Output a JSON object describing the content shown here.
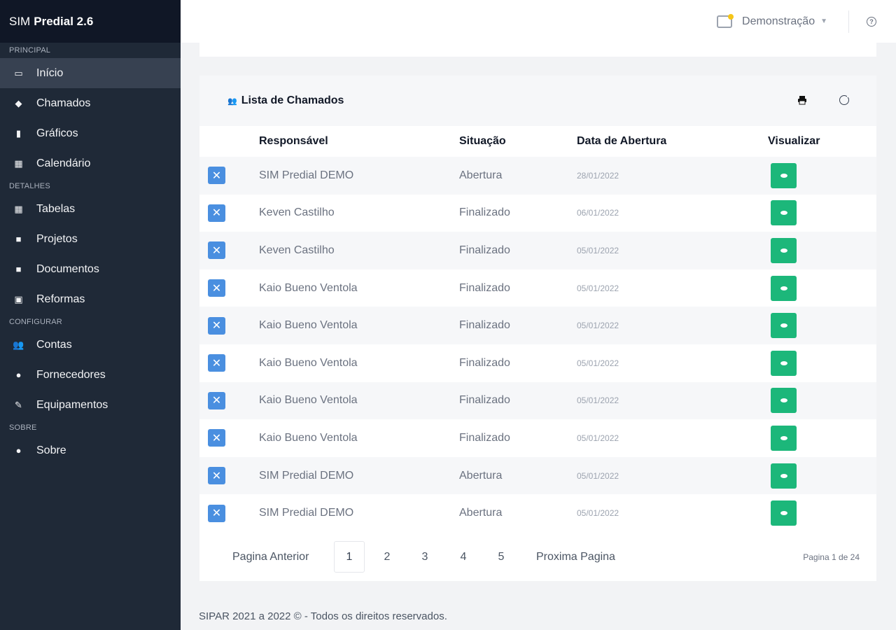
{
  "brand": {
    "prefix": "SIM",
    "name": "Predial 2.6"
  },
  "sidebar": {
    "sections": [
      {
        "label": "PRINCIPAL",
        "items": [
          {
            "label": "Início",
            "icon": "monitor-icon",
            "glyph": "▭",
            "active": true
          },
          {
            "label": "Chamados",
            "icon": "bullhorn-icon",
            "glyph": "◆"
          },
          {
            "label": "Gráficos",
            "icon": "chart-bar-icon",
            "glyph": "▮"
          },
          {
            "label": "Calendário",
            "icon": "calendar-icon",
            "glyph": "▦"
          }
        ]
      },
      {
        "label": "DETALHES",
        "items": [
          {
            "label": "Tabelas",
            "icon": "table-icon",
            "glyph": "▦"
          },
          {
            "label": "Projetos",
            "icon": "book-icon",
            "glyph": "■"
          },
          {
            "label": "Documentos",
            "icon": "document-icon",
            "glyph": "■"
          },
          {
            "label": "Reformas",
            "icon": "clipboard-icon",
            "glyph": "▣"
          }
        ]
      },
      {
        "label": "CONFIGURAR",
        "items": [
          {
            "label": "Contas",
            "icon": "users-icon",
            "glyph": "👥"
          },
          {
            "label": "Fornecedores",
            "icon": "user-icon",
            "glyph": "●"
          },
          {
            "label": "Equipamentos",
            "icon": "wrench-icon",
            "glyph": "✎"
          }
        ]
      },
      {
        "label": "SOBRE",
        "items": [
          {
            "label": "Sobre",
            "icon": "info-circle-icon",
            "glyph": "●"
          }
        ]
      }
    ]
  },
  "topbar": {
    "org_name": "Demonstração",
    "help_glyph": "?"
  },
  "card": {
    "title": "Lista de Chamados",
    "columns": {
      "responsavel": "Responsável",
      "situacao": "Situação",
      "data": "Data de Abertura",
      "visualizar": "Visualizar"
    },
    "rows": [
      {
        "responsavel": "SIM Predial DEMO",
        "situacao": "Abertura",
        "data": "28/01/2022"
      },
      {
        "responsavel": "Keven Castilho",
        "situacao": "Finalizado",
        "data": "06/01/2022"
      },
      {
        "responsavel": "Keven Castilho",
        "situacao": "Finalizado",
        "data": "05/01/2022"
      },
      {
        "responsavel": "Kaio Bueno Ventola",
        "situacao": "Finalizado",
        "data": "05/01/2022"
      },
      {
        "responsavel": "Kaio Bueno Ventola",
        "situacao": "Finalizado",
        "data": "05/01/2022"
      },
      {
        "responsavel": "Kaio Bueno Ventola",
        "situacao": "Finalizado",
        "data": "05/01/2022"
      },
      {
        "responsavel": "Kaio Bueno Ventola",
        "situacao": "Finalizado",
        "data": "05/01/2022"
      },
      {
        "responsavel": "Kaio Bueno Ventola",
        "situacao": "Finalizado",
        "data": "05/01/2022"
      },
      {
        "responsavel": "SIM Predial DEMO",
        "situacao": "Abertura",
        "data": "05/01/2022"
      },
      {
        "responsavel": "SIM Predial DEMO",
        "situacao": "Abertura",
        "data": "05/01/2022"
      }
    ]
  },
  "pagination": {
    "prev_label": "Pagina Anterior",
    "pages": [
      "1",
      "2",
      "3",
      "4",
      "5"
    ],
    "current": "1",
    "next_label": "Proxima Pagina",
    "info": "Pagina 1 de 24"
  },
  "footer": {
    "text": "SIPAR 2021 a 2022 © - Todos os direitos reservados."
  },
  "colors": {
    "sidebar": "#1f2937",
    "brand_bar": "#101726",
    "accent_green": "#1cb77a",
    "tool_blue": "#4a8fe0"
  }
}
